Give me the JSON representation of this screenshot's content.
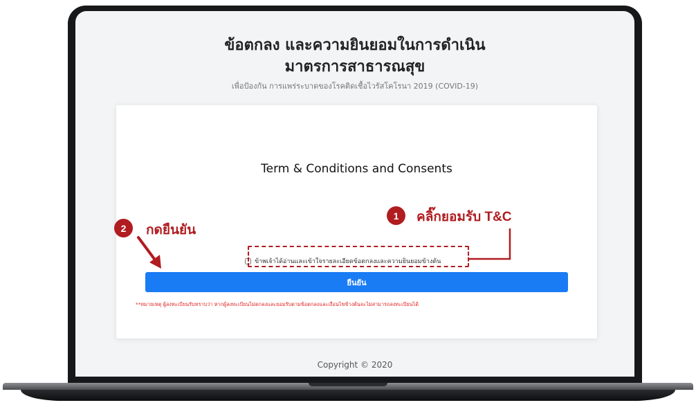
{
  "page": {
    "title_line1": "ข้อตกลง และความยินยอมในการดำเนิน",
    "title_line2": "มาตรการสาธารณสุข",
    "subtitle": "เพื่อป้องกัน การแพร่ระบาดของโรคติดเชื้อไวรัสโคโรนา 2019 (COVID-19)"
  },
  "card": {
    "heading": "Term & Conditions and Consents",
    "consent_label": "ข้าพเจ้าได้อ่านและเข้าใจรายละเอียดข้อตกลงและความยินยอมข้างต้น",
    "consent_checked": false,
    "confirm_label": "ยืนยัน",
    "note": "**หมายเหตุ ผู้ลงทะเบียนรับทราบว่า หากผู้ลงทะเบียนไม่ตกลงและยอมรับตามข้อตกลงและเงื่อนไขข้างต้นจะไม่สามารถลงทะเบียนได้"
  },
  "footer": {
    "copyright": "Copyright © 2020"
  },
  "annotations": {
    "step1_number": "1",
    "step1_text": "คลิ๊กยอมรับ T&C",
    "step2_number": "2",
    "step2_text": "กดยืนยัน",
    "color": "#b01c20"
  },
  "colors": {
    "button": "#1a7cf5",
    "note": "#e02424",
    "frame": "#17181a"
  }
}
